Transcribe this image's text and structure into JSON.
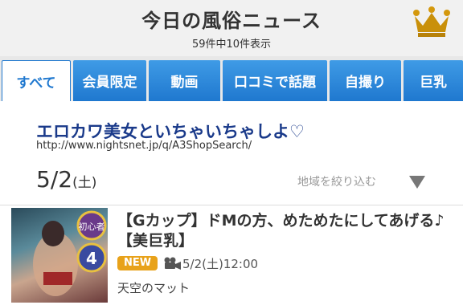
{
  "header": {
    "title": "今日の風俗ニュース",
    "subtitle": "59件中10件表示",
    "crown_icon": "crown-icon",
    "crown_color": "#c9900a"
  },
  "tabs": [
    {
      "label": "すべて",
      "active": true
    },
    {
      "label": "会員限定",
      "active": false
    },
    {
      "label": "動画",
      "active": false
    },
    {
      "label": "口コミで話題",
      "active": false
    },
    {
      "label": "自撮り",
      "active": false
    },
    {
      "label": "巨乳",
      "active": false
    }
  ],
  "promo": {
    "title": "エロカワ美女といちゃいちゃしよ♡",
    "url": "http://www.nightsnet.jp/q/A3ShopSearch/"
  },
  "date_section": {
    "date": "5/2",
    "day": "(土)",
    "filter_label": "地域を絞り込む"
  },
  "news_item": {
    "title": "【Gカップ】ドMの方、めためたにしてあげる♪【美巨乳】",
    "badge": "NEW",
    "datetime": "5/2(土)12:00",
    "shop": "天空のマット",
    "thumbnail_labels": [
      "初心者",
      "4"
    ]
  },
  "colors": {
    "tab_blue": "#1f78cf",
    "promo_title": "#1a3a8a",
    "badge": "#e8a21a"
  }
}
